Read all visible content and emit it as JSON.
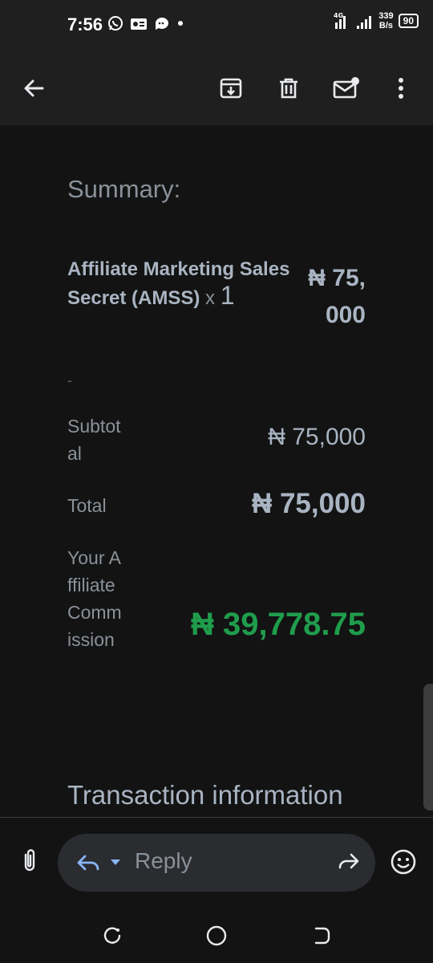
{
  "status_bar": {
    "time": "7:56",
    "network_type": "4G",
    "speed_value": "339",
    "speed_unit": "B/s",
    "battery": "90"
  },
  "toolbar": {
    "back_icon": "arrow-left-icon",
    "archive_icon": "archive-icon",
    "delete_icon": "trash-icon",
    "unread_icon": "mark-unread-icon",
    "more_icon": "more-vert-icon"
  },
  "email": {
    "summary_title": "Summary:",
    "product_name": "Affiliate Marketing Sales Secret (AMSS)",
    "qty_prefix": "x",
    "qty": "1",
    "product_price": "₦ 75,000",
    "dash": "-",
    "subtotal_label": "Subtotal",
    "subtotal_value": "₦ 75,000",
    "total_label": "Total",
    "total_value": "₦ 75,000",
    "commission_label": "Your Affiliate Commission",
    "commission_value": "₦ 39,778.75",
    "transaction_heading": "Transaction information"
  },
  "reply_bar": {
    "reply_placeholder": "Reply"
  },
  "colors": {
    "commission_green": "#1f9d4c",
    "background": "#131313",
    "bar": "#1f1f1f"
  }
}
